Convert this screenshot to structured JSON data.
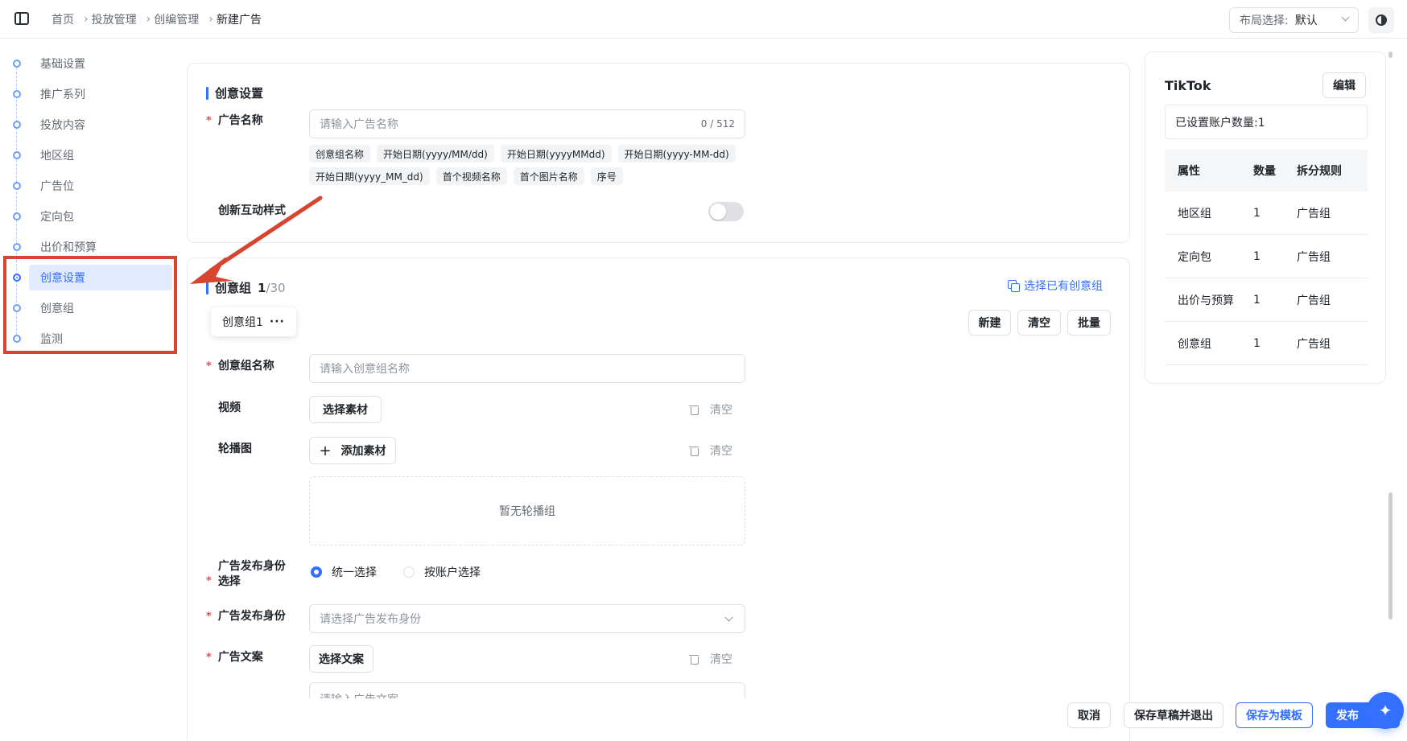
{
  "header": {
    "breadcrumb": [
      "首页",
      "投放管理",
      "创编管理",
      "新建广告"
    ],
    "layout_label": "布局选择:",
    "layout_value": "默认"
  },
  "nav": {
    "items": [
      "基础设置",
      "推广系列",
      "投放内容",
      "地区组",
      "广告位",
      "定向包",
      "出价和预算",
      "创意设置",
      "创意组",
      "监测"
    ],
    "active_index": 7
  },
  "creative_settings": {
    "title": "创意设置",
    "ad_name_label": "广告名称",
    "ad_name_placeholder": "请输入广告名称",
    "ad_name_counter": "0 / 512",
    "tags": [
      "创意组名称",
      "开始日期(yyyy/MM/dd)",
      "开始日期(yyyyMMdd)",
      "开始日期(yyyy-MM-dd)",
      "开始日期(yyyy_MM_dd)",
      "首个视频名称",
      "首个图片名称",
      "序号"
    ],
    "interactive_label": "创新互动样式",
    "interactive_enabled": false
  },
  "creative_group": {
    "title": "创意组",
    "count": "1",
    "total": "/30",
    "select_existing": "选择已有创意组",
    "tab_label": "创意组1",
    "tab_more": "···",
    "btn_new": "新建",
    "btn_clear": "清空",
    "btn_batch": "批量",
    "name_label": "创意组名称",
    "name_placeholder": "请输入创意组名称",
    "video_label": "视频",
    "video_btn": "选择素材",
    "clear_text": "清空",
    "carousel_label": "轮播图",
    "carousel_btn_plus": "+",
    "carousel_btn": "添加素材",
    "carousel_empty": "暂无轮播组",
    "identity_select_label_1": "广告发布身份",
    "identity_select_label_2": "选择",
    "radio_unified": "统一选择",
    "radio_by_account": "按账户选择",
    "identity_label": "广告发布身份",
    "identity_placeholder": "请选择广告发布身份",
    "copy_label": "广告文案",
    "copy_btn": "选择文案",
    "copy_placeholder": "请输入广告文案"
  },
  "right_panel": {
    "title": "TikTok",
    "edit_btn": "编辑",
    "account_count": "已设置账户数量:1",
    "table_headers": [
      "属性",
      "数量",
      "拆分规则"
    ],
    "rows": [
      [
        "地区组",
        "1",
        "广告组"
      ],
      [
        "定向包",
        "1",
        "广告组"
      ],
      [
        "出价与预算",
        "1",
        "广告组"
      ],
      [
        "创意组",
        "1",
        "广告组"
      ]
    ]
  },
  "footer": {
    "cancel": "取消",
    "save_draft": "保存草稿并退出",
    "save_template": "保存为模板",
    "publish": "发布"
  },
  "colors": {
    "primary": "#3370ff",
    "annotation": "#d6452f"
  },
  "icons": {
    "fab": "sparkle-icon"
  }
}
